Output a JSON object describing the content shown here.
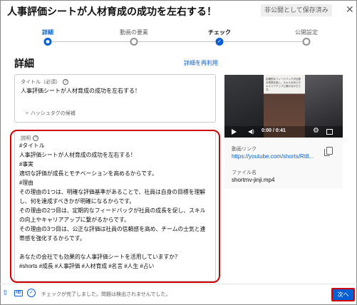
{
  "header": {
    "title": "人事評価シートが人材育成の成功を左右する！",
    "draft_badge": "非公開として保存済み",
    "close_icon": "close-icon"
  },
  "stepper": {
    "steps": [
      {
        "label": "詳細",
        "state": "current"
      },
      {
        "label": "動画の要素",
        "state": "future"
      },
      {
        "label": "チェック",
        "state": "done"
      },
      {
        "label": "公開設定",
        "state": "future"
      }
    ]
  },
  "details": {
    "heading": "詳細",
    "reuse_link": "詳細を再利用",
    "title_field": {
      "label": "タイトル（必須）",
      "value": "人事評価シートが人材育成の成功を左右する！",
      "hashtag_hint": "ハッシュタグの候補"
    },
    "description_field": {
      "label": "説明",
      "lines": [
        "#タイトル",
        "人事評価シートが人材育成の成功を左右する！",
        "#事実",
        "適切な評価が成長とモチベーションを高めるからです。",
        "#理由",
        "その理由の1つは、明確な評価基準があることで、社員は自身の目標を理解",
        "し、何を達成すべきかが明確になるからです。",
        "その理由の2つ目は、定期的なフィードバックが社員の成長を促し、スキル",
        "の向上やキャリアアップに繋がるからです。",
        "その理由の3つ目は、公正な評価は社員の信頼感を高め、チームの士気と連",
        "帯感を強化するからです。",
        "",
        "あなたの会社でも効果的な人事評価シートを活用していますか？",
        "#shorts #成長 #人事評価 #人材育成 #名言 #人生 #占い"
      ]
    }
  },
  "video": {
    "time": "0:00 / 0:41",
    "link_label": "動画リンク",
    "link_value": "https://youtube.com/shorts/Rt8...",
    "file_label": "ファイル名",
    "file_value": "shortmv-jinji.mp4",
    "thumbnail_caption": "定期的なフィードバックが社員の成長を促し、スキルの向上やキャリアアップに繋がるからです。"
  },
  "footer": {
    "status": "チェックが完了しました。問題は検出されませんでした。",
    "next_button": "次へ",
    "hd_label": "HD"
  },
  "colors": {
    "accent": "#065fd4",
    "highlight": "#d30000"
  }
}
